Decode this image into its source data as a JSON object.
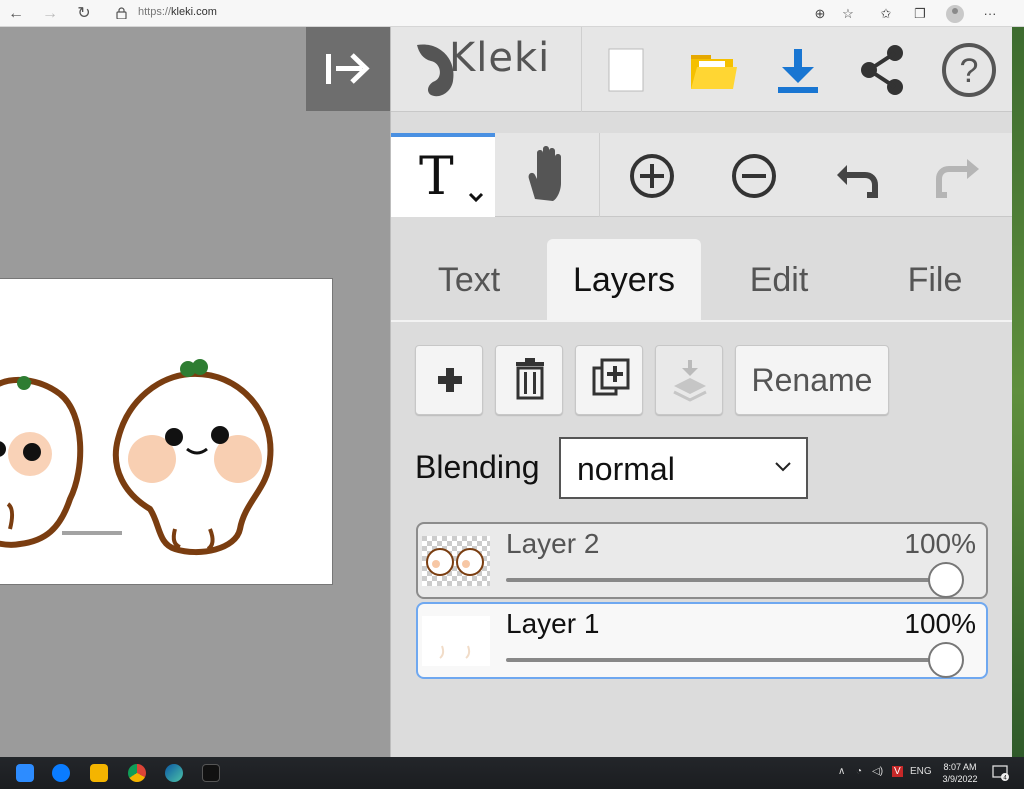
{
  "browser": {
    "url_prefix": "https://",
    "url_host": "kleki.com",
    "nav": {
      "back": "←",
      "forward": "→",
      "reload": "↻"
    },
    "more": "···"
  },
  "app": {
    "logo_text": "Kleki",
    "top_icons": [
      "new-image-icon",
      "open-folder-icon",
      "download-icon",
      "share-icon",
      "help-icon"
    ],
    "colors": {
      "accent": "#4a90e2",
      "download": "#1976d2",
      "folder": "#f5c000"
    }
  },
  "toolbar": {
    "text_tool_glyph": "T",
    "tools": [
      "text-tool",
      "hand-tool",
      "zoom-in",
      "zoom-out",
      "undo",
      "redo"
    ]
  },
  "tabs": [
    {
      "label": "Text",
      "active": false
    },
    {
      "label": "Layers",
      "active": true
    },
    {
      "label": "Edit",
      "active": false
    },
    {
      "label": "File",
      "active": false
    }
  ],
  "layers_panel": {
    "rename_label": "Rename",
    "blending_label": "Blending",
    "blending_value": "normal",
    "layers": [
      {
        "name": "Layer 2",
        "opacity": "100%",
        "opacity_value": 1.0,
        "active": false
      },
      {
        "name": "Layer 1",
        "opacity": "100%",
        "opacity_value": 1.0,
        "active": true
      }
    ]
  },
  "taskbar": {
    "tray_lang": "ENG",
    "time": "8:07 AM",
    "date": "3/9/2022",
    "notif_count": "4"
  }
}
